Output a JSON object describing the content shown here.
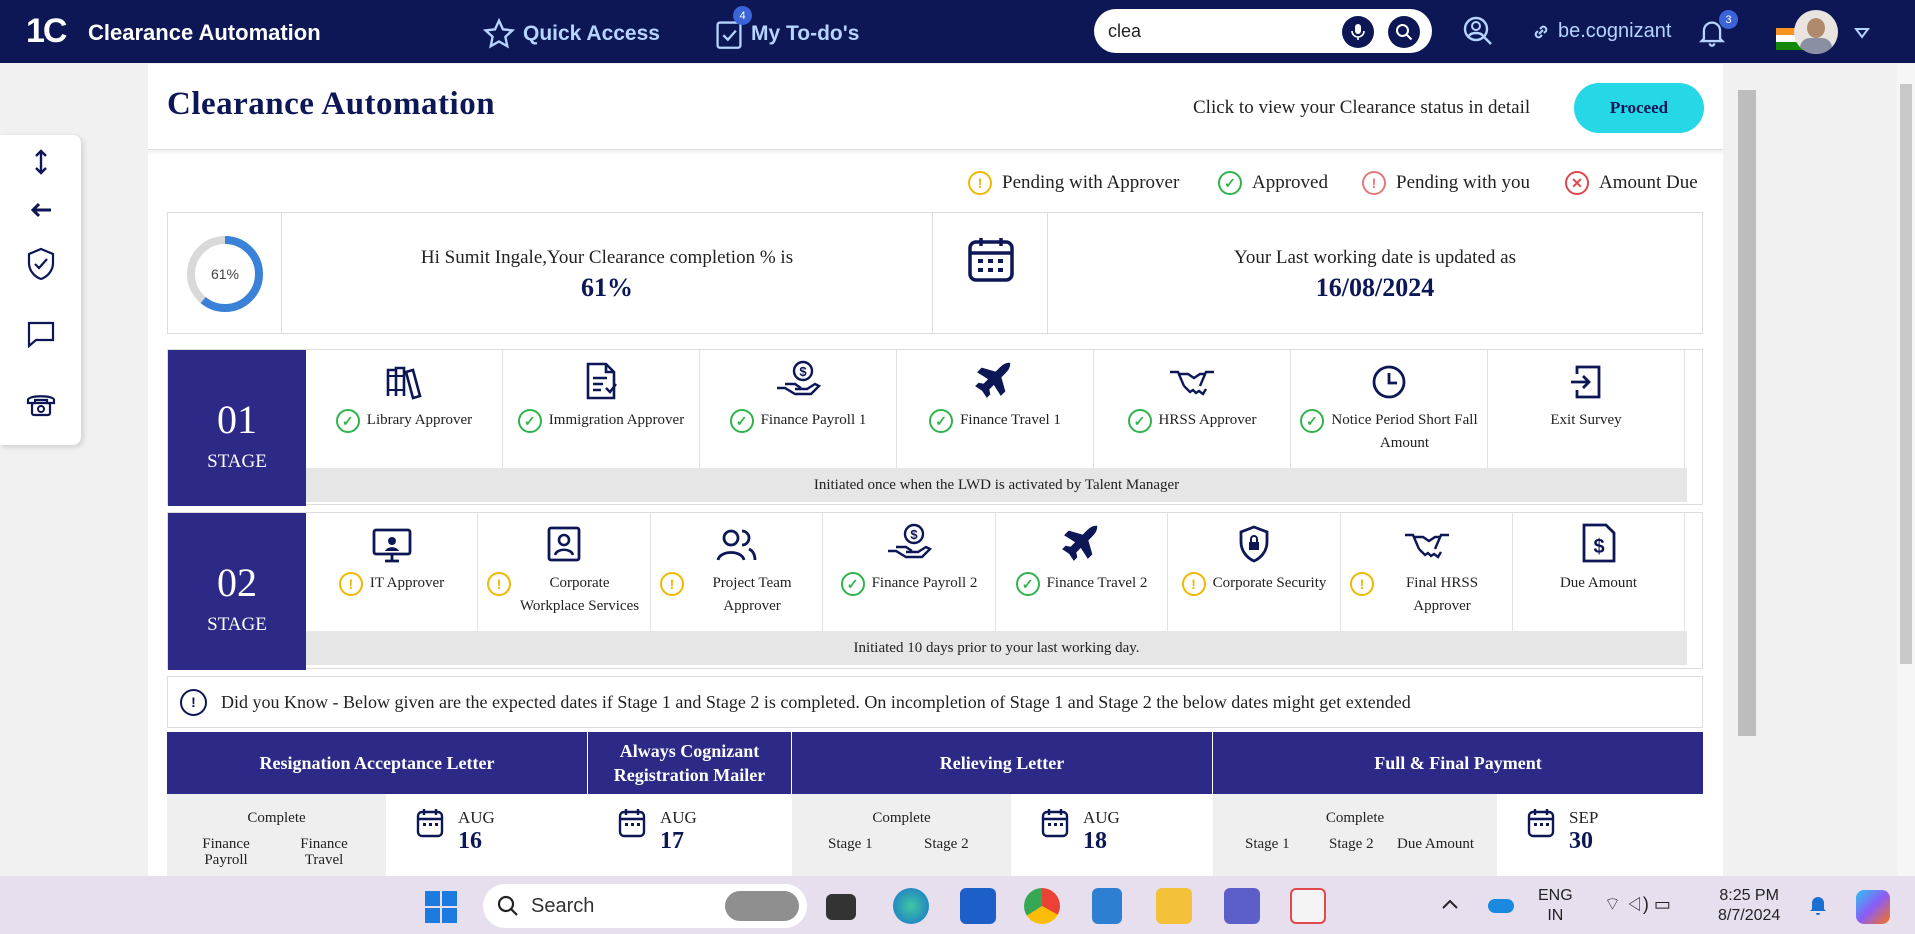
{
  "topbar": {
    "logo": "1C",
    "app_title": "Clearance Automation",
    "quick_access": "Quick Access",
    "todos": "My To-do's",
    "todos_count": "4",
    "search_value": "clea",
    "link_label": "be.cognizant",
    "notif_count": "3"
  },
  "header": {
    "title": "Clearance Automation",
    "hint": "Click to view your Clearance status in detail",
    "proceed": "Proceed"
  },
  "legend": {
    "pending_approver": "Pending with Approver",
    "approved": "Approved",
    "pending_you": "Pending with you",
    "amount_due": "Amount Due"
  },
  "summary": {
    "percent_label": "61%",
    "completion_fraction": 0.61,
    "greeting": "Hi Sumit Ingale,Your Clearance completion % is",
    "percent": "61%",
    "lwd_text": "Your Last working date is updated as",
    "lwd_date": "16/08/2024"
  },
  "stage1": {
    "num": "01",
    "label": "STAGE",
    "note": "Initiated once when the LWD is activated by Talent Manager",
    "items": [
      {
        "label": "Library Approver",
        "status": "approved"
      },
      {
        "label": "Immigration Approver",
        "status": "approved"
      },
      {
        "label": "Finance Payroll 1",
        "status": "approved"
      },
      {
        "label": "Finance Travel 1",
        "status": "approved"
      },
      {
        "label": "HRSS Approver",
        "status": "approved"
      },
      {
        "label": "Notice Period Short Fall Amount",
        "status": "approved"
      },
      {
        "label": "Exit Survey",
        "status": "none"
      }
    ]
  },
  "stage2": {
    "num": "02",
    "label": "STAGE",
    "note": "Initiated 10 days prior to your last working day.",
    "items": [
      {
        "label": "IT Approver",
        "status": "pending"
      },
      {
        "label": "Corporate Workplace Services",
        "status": "pending"
      },
      {
        "label": "Project Team Approver",
        "status": "pending"
      },
      {
        "label": "Finance Payroll 2",
        "status": "approved"
      },
      {
        "label": "Finance Travel 2",
        "status": "approved"
      },
      {
        "label": "Corporate Security",
        "status": "pending"
      },
      {
        "label": "Final HRSS Approver",
        "status": "pending"
      },
      {
        "label": "Due Amount",
        "status": "none"
      }
    ]
  },
  "did_you_know": "Did you Know - Below given are the expected dates if Stage 1 and Stage 2 is completed. On incompletion of Stage 1 and Stage 2 the below dates might get extended",
  "timeline": {
    "headers": [
      "Resignation Acceptance Letter",
      "Always Cognizant Registration Mailer",
      "Relieving Letter",
      "Full & Final Payment"
    ],
    "complete": "Complete",
    "col1_a": "Finance Payroll",
    "col1_b": "Finance Travel",
    "col3_a": "Stage 1",
    "col3_b": "Stage 2",
    "col4_a": "Stage 1",
    "col4_b": "Stage 2",
    "col4_c": "Due Amount",
    "dates": [
      {
        "mon": "AUG",
        "day": "16"
      },
      {
        "mon": "AUG",
        "day": "17"
      },
      {
        "mon": "AUG",
        "day": "18"
      },
      {
        "mon": "SEP",
        "day": "30"
      }
    ]
  },
  "taskbar": {
    "search": "Search",
    "lang1": "ENG",
    "lang2": "IN",
    "time": "8:25 PM",
    "date": "8/7/2024"
  },
  "colors": {
    "navy": "#0d1756",
    "stage": "#2d2a87",
    "approved": "#2fb34a",
    "pending": "#f0b800",
    "pending_you": "#e07a7a",
    "due": "#e0454b",
    "proceed": "#26d7e6"
  }
}
